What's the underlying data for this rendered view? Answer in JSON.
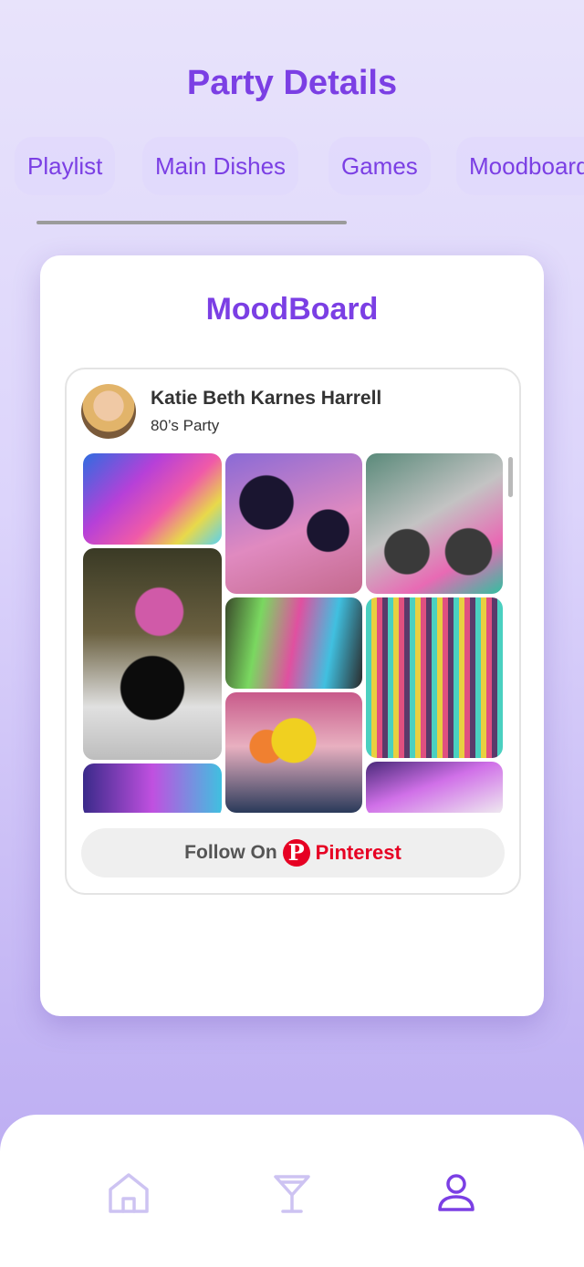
{
  "header": {
    "title": "Party Details"
  },
  "tabs": [
    {
      "label": "Playlist"
    },
    {
      "label": "Main Dishes"
    },
    {
      "label": "Games"
    },
    {
      "label": "Moodboard"
    }
  ],
  "moodboard": {
    "title": "MoodBoard",
    "author": "Katie Beth Karnes Harrell",
    "board": "80’s Party",
    "follow_label": "Follow On",
    "follow_brand": "Pinterest",
    "pins": [
      {
        "name": "neon-party-pin"
      },
      {
        "name": "vinyl-records-ceiling-pin"
      },
      {
        "name": "candy-boombox-pin"
      },
      {
        "name": "record-centerpiece-pin"
      },
      {
        "name": "neon-slinky-pin"
      },
      {
        "name": "hanging-slinkies-pin"
      },
      {
        "name": "flower-centerpiece-pin"
      },
      {
        "name": "neon-balloons-pin"
      },
      {
        "name": "purple-room-pin"
      }
    ]
  },
  "nav": {
    "items": [
      {
        "icon": "home-icon"
      },
      {
        "icon": "cocktail-icon"
      },
      {
        "icon": "profile-icon"
      }
    ],
    "active_color": "#7b3fe4",
    "inactive_color": "#cdc3f2"
  },
  "colors": {
    "accent": "#7b3fe4",
    "pinterest": "#e60023"
  }
}
